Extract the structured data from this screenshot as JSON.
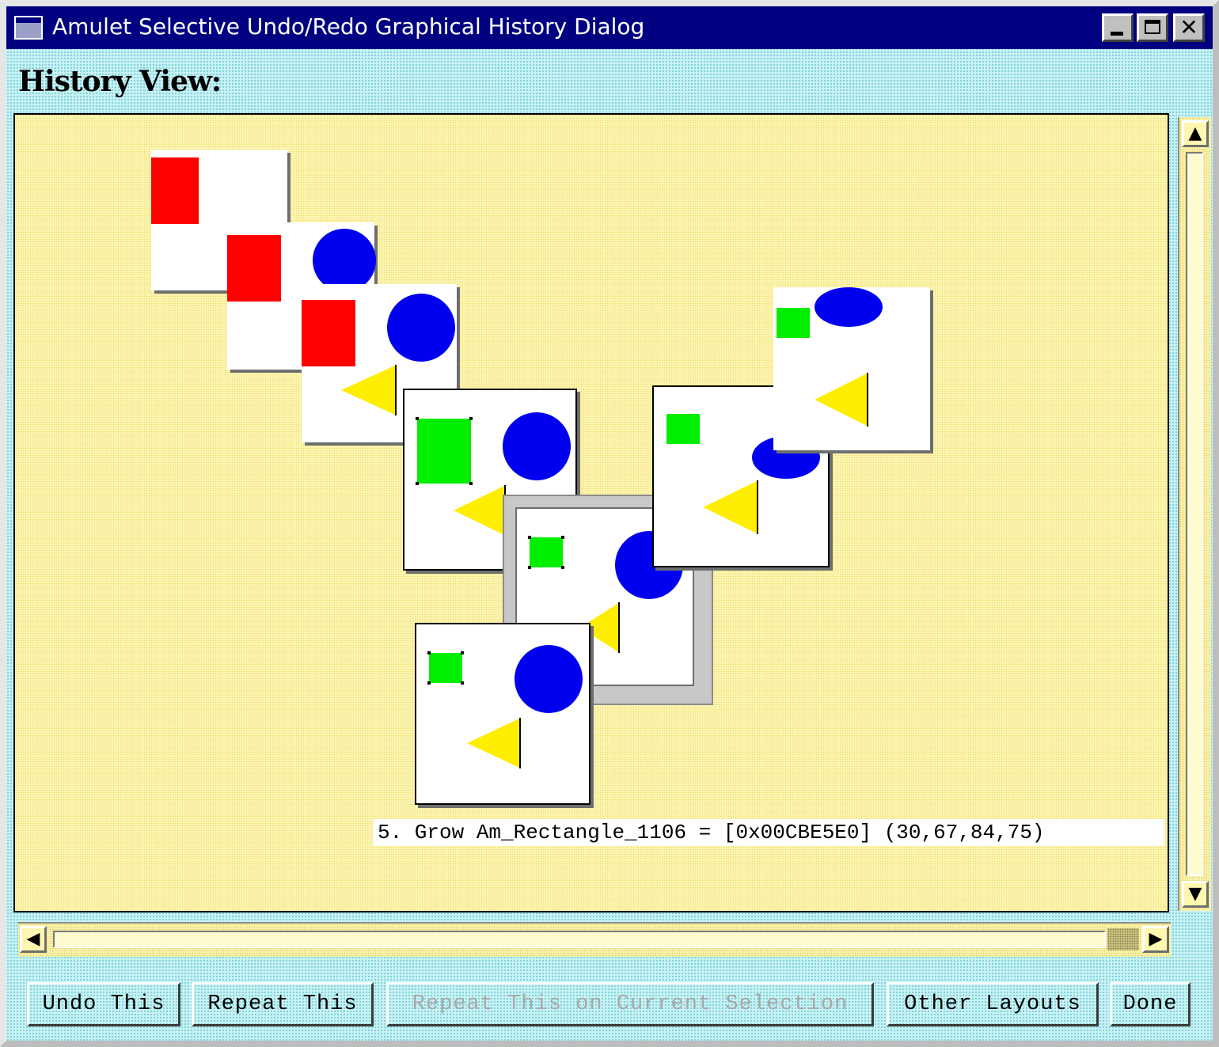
{
  "window": {
    "title": "Amulet Selective Undo/Redo Graphical History Dialog",
    "controls": {
      "minimize": "_",
      "maximize": "□",
      "close": "✕"
    }
  },
  "history_label": "History View:",
  "status_line": "5. Grow Am_Rectangle_1106 = [0x00CBE5E0] (30,67,84,75)",
  "scrollbars": {
    "vertical": {
      "up_icon": "▲",
      "down_icon": "▼"
    },
    "horizontal": {
      "left_icon": "◀",
      "right_icon": "▶"
    }
  },
  "buttons": {
    "undo": "Undo This",
    "repeat": "Repeat This",
    "repeat_selection": "Repeat This on Current Selection",
    "other_layouts": "Other Layouts",
    "done": "Done"
  },
  "shape_colors": {
    "rectangle_red": "#ff0000",
    "rectangle_green": "#00ee00",
    "circle_blue": "#0000ee",
    "triangle_yellow": "#ffee00"
  }
}
